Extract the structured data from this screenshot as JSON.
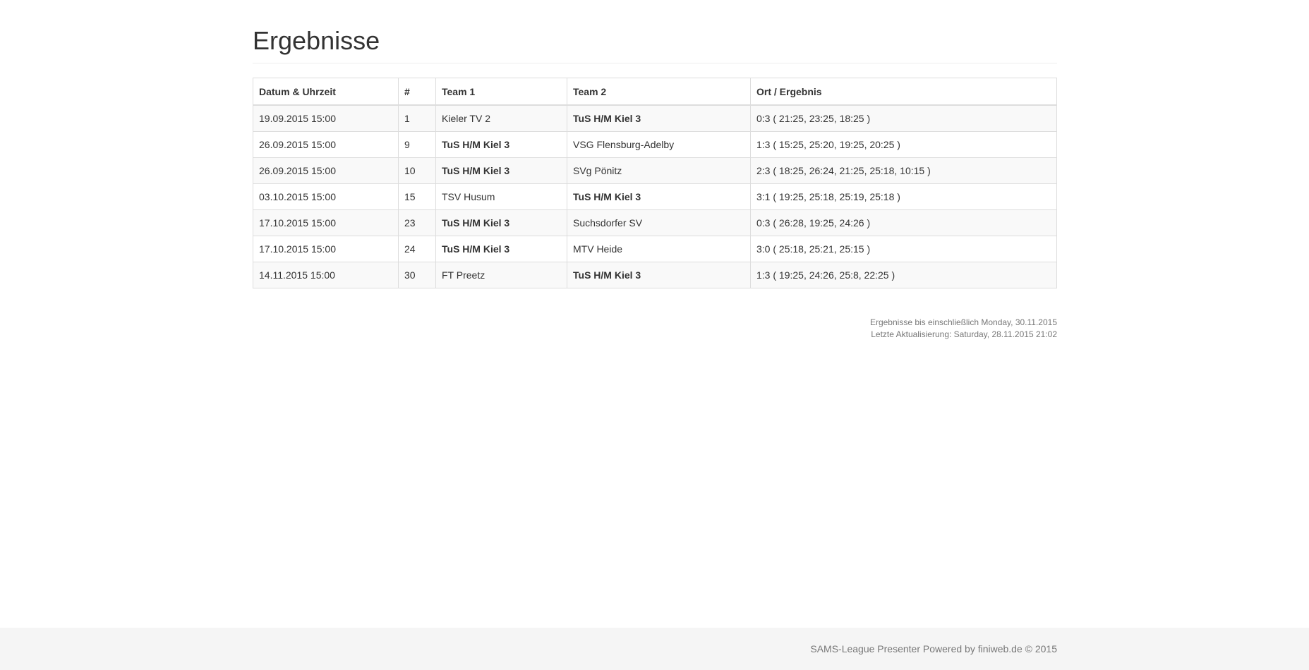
{
  "page": {
    "title": "Ergebnisse"
  },
  "table": {
    "headers": {
      "datetime": "Datum & Uhrzeit",
      "number": "#",
      "team1": "Team 1",
      "team2": "Team 2",
      "result": "Ort / Ergebnis"
    },
    "rows": [
      {
        "datetime": "19.09.2015 15:00",
        "number": "1",
        "team1": "Kieler TV 2",
        "team2": "TuS H/M Kiel 3",
        "result": "0:3 ( 21:25, 23:25, 18:25 )",
        "own": "team2"
      },
      {
        "datetime": "26.09.2015 15:00",
        "number": "9",
        "team1": "TuS H/M Kiel 3",
        "team2": "VSG Flensburg-Adelby",
        "result": "1:3 ( 15:25, 25:20, 19:25, 20:25 )",
        "own": "team1"
      },
      {
        "datetime": "26.09.2015 15:00",
        "number": "10",
        "team1": "TuS H/M Kiel 3",
        "team2": "SVg Pönitz",
        "result": "2:3 ( 18:25, 26:24, 21:25, 25:18, 10:15 )",
        "own": "team1"
      },
      {
        "datetime": "03.10.2015 15:00",
        "number": "15",
        "team1": "TSV Husum",
        "team2": "TuS H/M Kiel 3",
        "result": "3:1 ( 19:25, 25:18, 25:19, 25:18 )",
        "own": "team2"
      },
      {
        "datetime": "17.10.2015 15:00",
        "number": "23",
        "team1": "TuS H/M Kiel 3",
        "team2": "Suchsdorfer SV",
        "result": "0:3 ( 26:28, 19:25, 24:26 )",
        "own": "team1"
      },
      {
        "datetime": "17.10.2015 15:00",
        "number": "24",
        "team1": "TuS H/M Kiel 3",
        "team2": "MTV Heide",
        "result": "3:0 ( 25:18, 25:21, 25:15 )",
        "own": "team1"
      },
      {
        "datetime": "14.11.2015 15:00",
        "number": "30",
        "team1": "FT Preetz",
        "team2": "TuS H/M Kiel 3",
        "result": "1:3 ( 19:25, 24:26, 25:8, 22:25 )",
        "own": "team2"
      }
    ]
  },
  "meta": {
    "results_until": "Ergebnisse bis einschließlich Monday, 30.11.2015",
    "last_update": "Letzte Aktualisierung: Saturday, 28.11.2015 21:02"
  },
  "footer": {
    "text": "SAMS-League Presenter Powered by finiweb.de © 2015"
  }
}
